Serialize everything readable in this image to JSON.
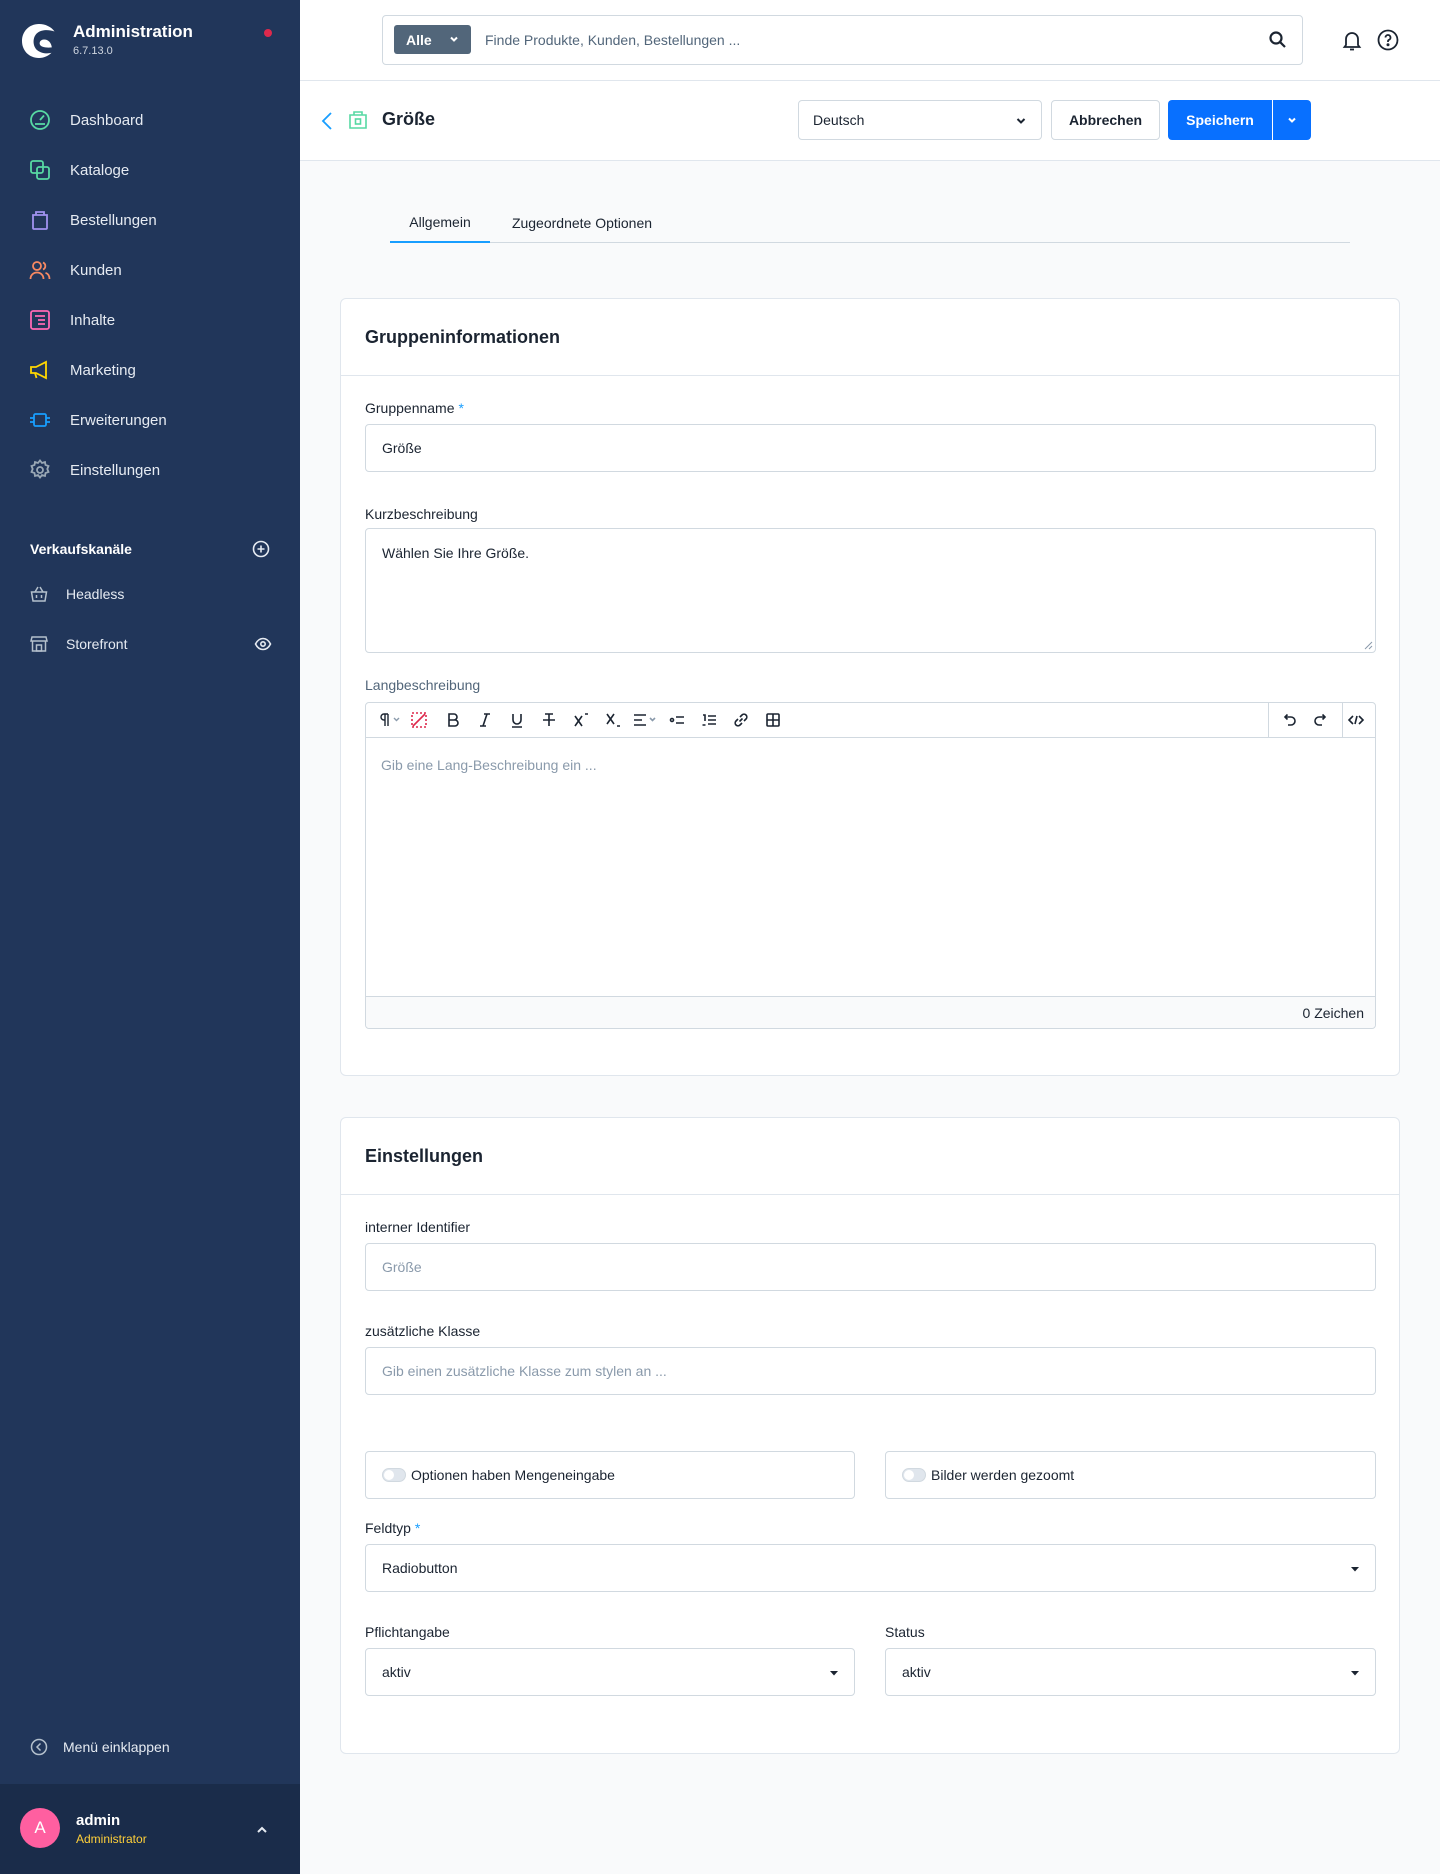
{
  "app": {
    "title": "Administration",
    "version": "6.7.13.0"
  },
  "nav": {
    "items": [
      {
        "label": "Dashboard",
        "icon": "dashboard-icon",
        "color": "#57d9a3"
      },
      {
        "label": "Kataloge",
        "icon": "catalog-icon",
        "color": "#57d9a3"
      },
      {
        "label": "Bestellungen",
        "icon": "shopping-bag-icon",
        "color": "#a092f0"
      },
      {
        "label": "Kunden",
        "icon": "customers-icon",
        "color": "#f88962"
      },
      {
        "label": "Inhalte",
        "icon": "content-icon",
        "color": "#ff68b4"
      },
      {
        "label": "Marketing",
        "icon": "megaphone-icon",
        "color": "#ffd700"
      },
      {
        "label": "Erweiterungen",
        "icon": "extensions-icon",
        "color": "#189eff"
      },
      {
        "label": "Einstellungen",
        "icon": "gear-icon",
        "color": "#9aa8b5"
      }
    ]
  },
  "sales_channels": {
    "title": "Verkaufskanäle",
    "items": [
      {
        "label": "Headless",
        "icon": "basket-icon"
      },
      {
        "label": "Storefront",
        "icon": "storefront-icon"
      }
    ]
  },
  "collapse_label": "Menü einklappen",
  "user": {
    "initial": "A",
    "name": "admin",
    "role": "Administrator"
  },
  "search": {
    "type_label": "Alle",
    "placeholder": "Finde Produkte, Kunden, Bestellungen ..."
  },
  "smartbar": {
    "title": "Größe",
    "language": "Deutsch",
    "cancel_label": "Abbrechen",
    "save_label": "Speichern"
  },
  "tabs": [
    {
      "label": "Allgemein",
      "active": true
    },
    {
      "label": "Zugeordnete Optionen",
      "active": false
    }
  ],
  "group_info": {
    "title": "Gruppeninformationen",
    "name_label": "Gruppenname",
    "required_mark": "*",
    "name_value": "Größe",
    "short_desc_label": "Kurzbeschreibung",
    "short_desc_value": "Wählen Sie Ihre Größe.",
    "long_desc_label": "Langbeschreibung",
    "long_desc_placeholder": "Gib eine Lang-Beschreibung ein ...",
    "char_count": "0 Zeichen"
  },
  "settings": {
    "title": "Einstellungen",
    "identifier_label": "interner Identifier",
    "identifier_placeholder": "Größe",
    "css_class_label": "zusätzliche Klasse",
    "css_class_placeholder": "Gib einen zusätzliche Klasse zum stylen an ...",
    "quantity_toggle_label": "Optionen haben Mengeneingabe",
    "quantity_toggle_on": false,
    "zoom_toggle_label": "Bilder werden gezoomt",
    "zoom_toggle_on": false,
    "field_type_label": "Feldtyp",
    "field_type_value": "Radiobutton",
    "required_label": "Pflichtangabe",
    "required_value": "aktiv",
    "status_label": "Status",
    "status_value": "aktiv"
  },
  "colors": {
    "sidebar_bg": "#21365a",
    "primary": "#0870ff",
    "accent": "#189eff",
    "notification_dot": "#de294c",
    "avatar": "#ff5fa0",
    "role_text": "#ffd03a"
  }
}
